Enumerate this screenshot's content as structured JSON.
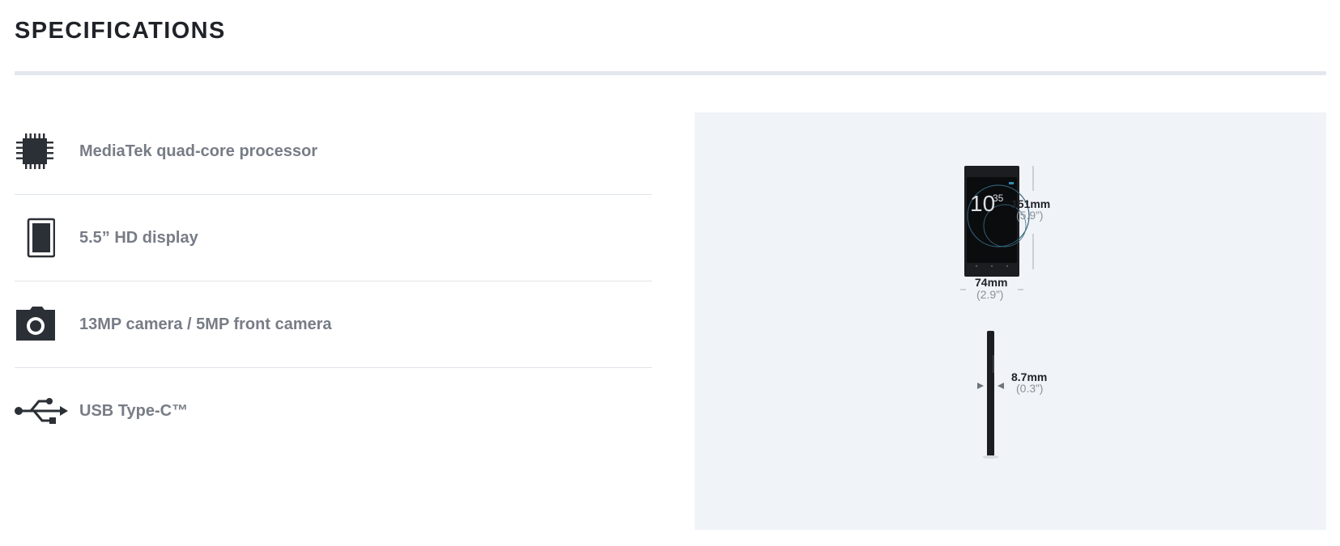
{
  "page": {
    "title": "SPECIFICATIONS"
  },
  "specs": [
    {
      "icon": "processor-chip-icon",
      "label": "MediaTek quad-core processor"
    },
    {
      "icon": "phone-display-icon",
      "label": "5.5” HD display"
    },
    {
      "icon": "camera-icon",
      "label": "13MP camera / 5MP front camera"
    },
    {
      "icon": "usb-icon",
      "label": "USB Type-C™"
    }
  ],
  "dimensions": {
    "height": {
      "metric": "151mm",
      "imperial": "(5.9”)"
    },
    "width": {
      "metric": "74mm",
      "imperial": "(2.9”)"
    },
    "depth": {
      "metric": "8.7mm",
      "imperial": "(0.3”)"
    },
    "screen_clock": {
      "hour": "10",
      "minute": "35"
    }
  },
  "colors": {
    "heading": "#1f2329",
    "label": "#777c86",
    "panel_bg": "#f0f3f7",
    "divider": "#dfe3e8"
  }
}
